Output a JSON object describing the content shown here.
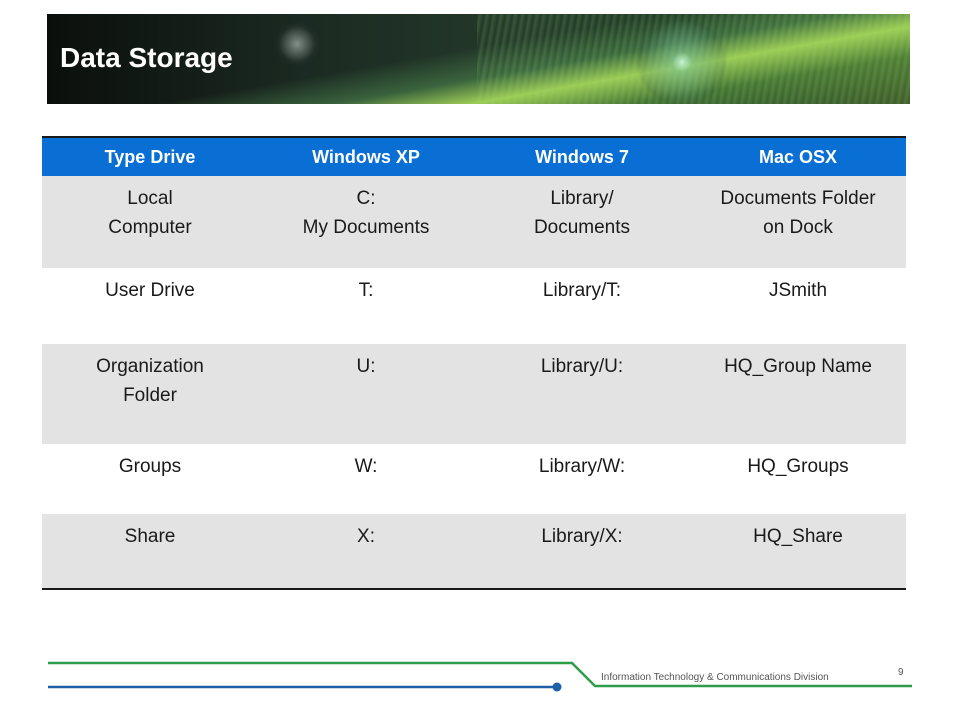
{
  "slide": {
    "title": "Data Storage",
    "footer": "Information Technology & Communications Division",
    "page_number": "9"
  },
  "table": {
    "headers": [
      "Type Drive",
      "Windows XP",
      "Windows 7",
      "Mac OSX"
    ],
    "rows": [
      [
        [
          "Local",
          "Computer"
        ],
        [
          "C:",
          "My Documents"
        ],
        [
          "Library/",
          "Documents"
        ],
        [
          "Documents Folder",
          "on Dock"
        ]
      ],
      [
        [
          "User Drive"
        ],
        [
          "T:"
        ],
        [
          "Library/T:"
        ],
        [
          "JSmith"
        ]
      ],
      [
        [
          "Organization",
          "Folder"
        ],
        [
          "U:"
        ],
        [
          "Library/U:"
        ],
        [
          "HQ_Group Name"
        ]
      ],
      [
        [
          "Groups"
        ],
        [
          "W:"
        ],
        [
          "Library/W:"
        ],
        [
          "HQ_Groups"
        ]
      ],
      [
        [
          "Share"
        ],
        [
          "X:"
        ],
        [
          "Library/X:"
        ],
        [
          "HQ_Share"
        ]
      ]
    ]
  },
  "colors": {
    "header_blue": "#0a6fd4",
    "shade_gray": "#e3e3e3",
    "footer_green": "#2e9d4a",
    "footer_blue": "#1f5fa8"
  }
}
